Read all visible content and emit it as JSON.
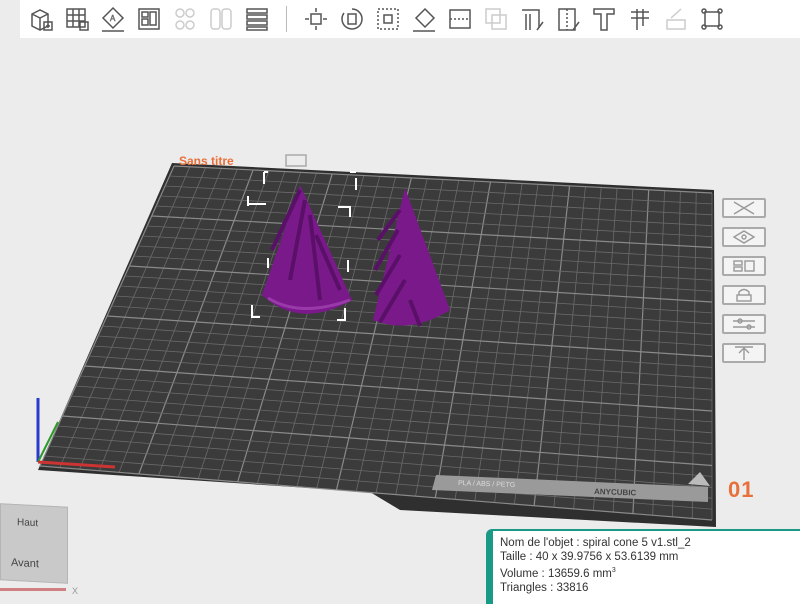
{
  "toolbar": {
    "items": [
      {
        "icon": "add-object-icon",
        "label": "Add object",
        "enabled": true
      },
      {
        "icon": "add-plate-icon",
        "label": "Add plate",
        "enabled": true
      },
      {
        "icon": "auto-orient-icon",
        "label": "Auto orient",
        "enabled": true
      },
      {
        "icon": "arrange-icon",
        "label": "Arrange",
        "enabled": true
      },
      {
        "icon": "copy-icon",
        "label": "Copy",
        "enabled": false
      },
      {
        "icon": "split-icon",
        "label": "Split",
        "enabled": false
      },
      {
        "icon": "layers-icon",
        "label": "Layers",
        "enabled": true
      },
      {
        "icon": "move-icon",
        "label": "Move",
        "enabled": true
      },
      {
        "icon": "rotate-icon",
        "label": "Rotate",
        "enabled": true
      },
      {
        "icon": "scale-icon",
        "label": "Scale",
        "enabled": true
      },
      {
        "icon": "lay-flat-icon",
        "label": "Lay on face",
        "enabled": true
      },
      {
        "icon": "cut-icon",
        "label": "Cut",
        "enabled": true
      },
      {
        "icon": "boolean-icon",
        "label": "Boolean",
        "enabled": false
      },
      {
        "icon": "support-paint-icon",
        "label": "Support painting",
        "enabled": true
      },
      {
        "icon": "seam-paint-icon",
        "label": "Seam painting",
        "enabled": true
      },
      {
        "icon": "text-icon",
        "label": "Text",
        "enabled": true
      },
      {
        "icon": "measure-icon",
        "label": "Measure",
        "enabled": true
      },
      {
        "icon": "assembly-icon",
        "label": "Assembly",
        "enabled": false
      },
      {
        "icon": "fit-view-icon",
        "label": "Fit view",
        "enabled": true
      }
    ]
  },
  "plate": {
    "name": "Sans titre",
    "number": "01",
    "material_label": "PLA / ABS / PETG",
    "brand_label": "ANYCUBIC"
  },
  "plate_tools": [
    {
      "icon": "close-plate-icon"
    },
    {
      "icon": "orient-plate-icon"
    },
    {
      "icon": "arrange-plate-icon"
    },
    {
      "icon": "lock-plate-icon"
    },
    {
      "icon": "plate-settings-icon"
    },
    {
      "icon": "move-up-icon"
    }
  ],
  "object_info": {
    "name": "Nom de l'objet : spiral cone 5 v1.stl_2",
    "size": "Taille : 40 x 39.9756 x 53.6139 mm",
    "volume": "Volume : 13659.6 mm",
    "volume_unit_sup": "3",
    "triangles": "Triangles : 33816"
  },
  "view_cube": {
    "top": "Haut",
    "front": "Avant",
    "x_axis": "X"
  },
  "colors": {
    "accent": "#e8703a",
    "object": "#7a1a8a",
    "info_border": "#1a9a86",
    "bed": "#3b3b3b"
  }
}
